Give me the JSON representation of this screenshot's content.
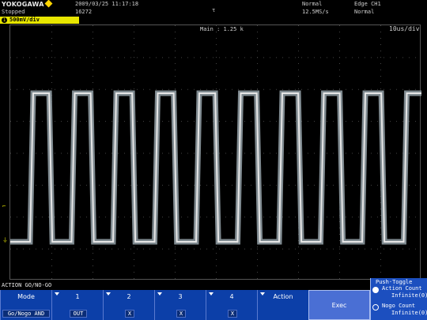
{
  "header": {
    "brand": "YOKOGAWA",
    "timestamp": "2009/03/25  11:17:18",
    "status": "Stopped",
    "acq_count": "16272",
    "acq_mode": "Normal",
    "sample_rate": "12.5MS/s",
    "trigger": "Edge CH1",
    "trigger_mode": "Normal",
    "trigger_marker": "τ"
  },
  "channel": {
    "number": "1",
    "label": "500mV/div",
    "color": "#e8e600"
  },
  "display": {
    "zoom_label": "Main : 1.25 k",
    "timebase": "10us/div",
    "waveform_color": "#dddddd",
    "envelope_color": "#7f8a90"
  },
  "softkeys": {
    "menu_title": "ACTION GO/NO-GO",
    "items": [
      {
        "label": "Mode",
        "value": "Go/Nogo AND"
      },
      {
        "label": "1",
        "value": "OUT"
      },
      {
        "label": "2",
        "value": "X"
      },
      {
        "label": "3",
        "value": "X"
      },
      {
        "label": "4",
        "value": "X"
      },
      {
        "label": "Action",
        "value": ""
      }
    ],
    "exec_label": "Exec"
  },
  "panel": {
    "push_toggle": "Push·Toggle",
    "option1_label": "Action Count",
    "option1_value": "Infinite(0)",
    "option2_label": "Nogo Count",
    "option2_value": "Infinite(0)"
  },
  "colors": {
    "softkey_bg": "#0c3fa8",
    "exec_bg": "#4a6fd4",
    "highlight": "#e8e600"
  }
}
